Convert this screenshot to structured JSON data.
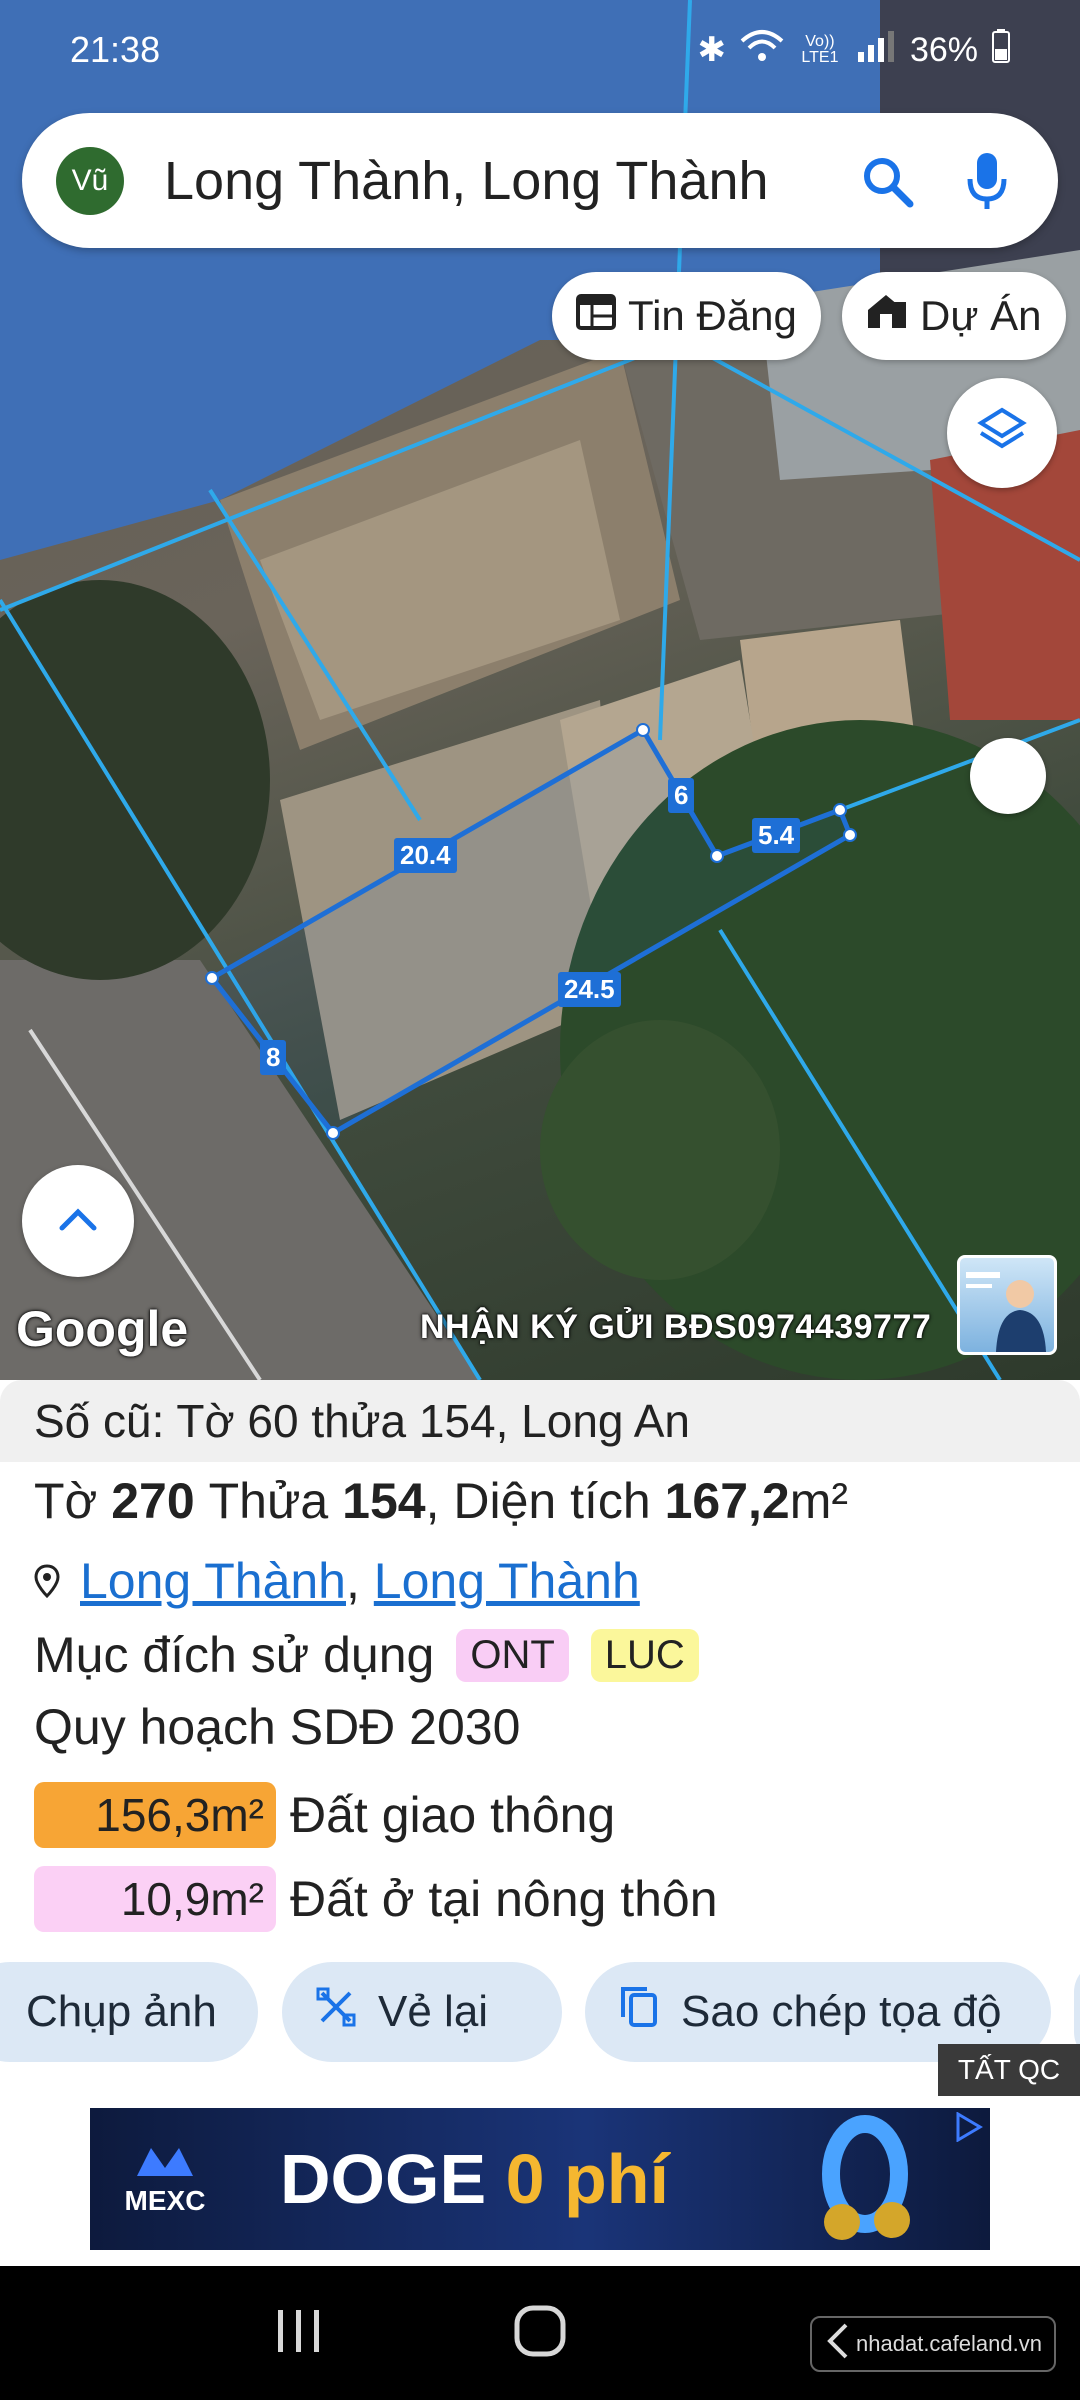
{
  "status_bar": {
    "time": "21:38",
    "network_label": "Vo)) LTE1",
    "battery": "36%"
  },
  "search": {
    "avatar_initials": "Vũ",
    "query": "Long Thành, Long Thành"
  },
  "chips": {
    "listings": "Tin Đăng",
    "projects": "Dự Án"
  },
  "map": {
    "dimensions": [
      "20.4",
      "6",
      "5.4",
      "24.5",
      "8"
    ],
    "google_logo": "Google",
    "watermark": "NHẬN KÝ GỬI BĐS0974439777"
  },
  "panel": {
    "old_info": "Số cũ: Tờ 60 thửa 154, Long An",
    "sheet_label": "Tờ ",
    "sheet_no": "270",
    "parcel_label": " Thửa ",
    "parcel_no": "154",
    "area_label": ", Diện tích ",
    "area_value": "167,2",
    "area_unit": "m²",
    "location": {
      "district": "Long Thành",
      "separator": ", ",
      "ward": "Long Thành"
    },
    "usage_label": "Mục đích sử dụng",
    "usage_tags": [
      {
        "code": "ONT",
        "color": "#f9cdf5"
      },
      {
        "code": "LUC",
        "color": "#fbf79b"
      }
    ],
    "plan_title": "Quy hoạch SDĐ 2030",
    "plan_items": [
      {
        "area": "156,3m²",
        "label": "Đất giao thông",
        "color": "#f7a535"
      },
      {
        "area": "10,9m²",
        "label": "Đất ở tại nông thôn",
        "color": "#fbd0f5"
      }
    ]
  },
  "actions": {
    "capture": "Chụp ảnh",
    "redraw": "Vẻ lại",
    "copy_coords": "Sao chép tọa độ"
  },
  "ad": {
    "close_label": "TẤT QC",
    "brand": "MEXC",
    "headline_main": "DOGE ",
    "headline_accent": "0 phí"
  },
  "nav": {
    "watermark": "nhadat.cafeland.vn"
  }
}
